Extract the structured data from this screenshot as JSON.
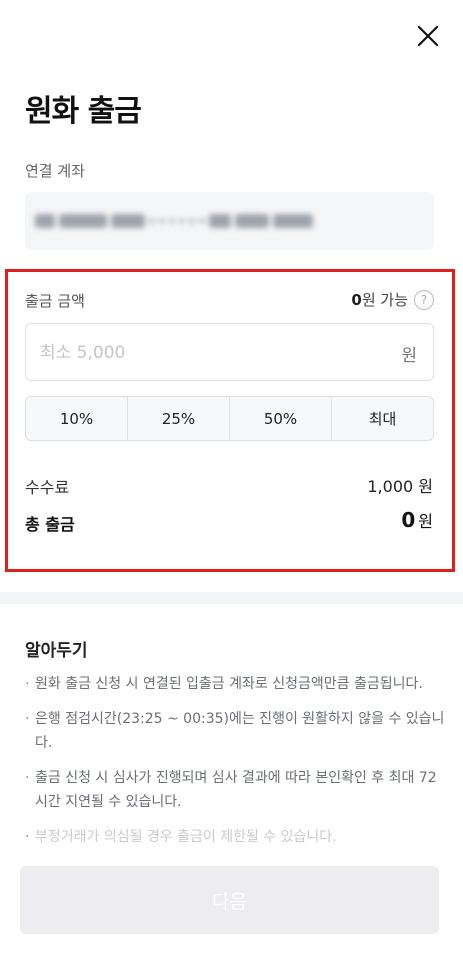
{
  "header": {
    "close_icon": "close-icon",
    "title": "원화 출금"
  },
  "account": {
    "label": "연결 계좌",
    "value_hidden": true
  },
  "withdraw": {
    "amount_label": "출금 금액",
    "available_amount": "0",
    "available_suffix": "원 가능",
    "help_icon": "?",
    "input_placeholder": "최소 5,000",
    "input_value": "",
    "input_unit": "원",
    "percent_buttons": [
      "10%",
      "25%",
      "50%",
      "최대"
    ],
    "fee_label": "수수료",
    "fee_value": "1,000 원",
    "total_label": "총 출금",
    "total_amount": "0",
    "total_unit": "원"
  },
  "notice": {
    "title": "알아두기",
    "items": [
      "원화 출금 신청 시 연결된 입출금 계좌로 신청금액만큼 출금됩니다.",
      "은행 점검시간(23:25 ~ 00:35)에는 진행이 원활하지 않을 수 있습니다.",
      "출금 신청 시 심사가 진행되며 심사 결과에 따라 본인확인 후 최대 72시간 지연될 수 있습니다.",
      "부정거래가 의심될 경우 출금이 제한될 수 있습니다."
    ]
  },
  "footer": {
    "next_label": "다음"
  },
  "colors": {
    "highlight_border": "#e01e1e",
    "disabled_button": "#ededef",
    "input_border": "#dcdfe4"
  }
}
